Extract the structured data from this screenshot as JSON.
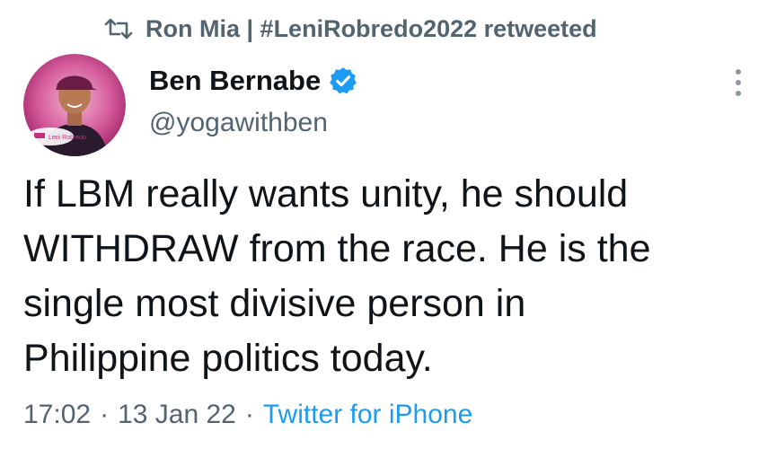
{
  "retweet": {
    "icon": "retweet-icon",
    "text": "Ron Mia | #LeniRobredo2022 retweeted"
  },
  "author": {
    "display_name": "Ben Bernabe",
    "handle": "@yogawithben",
    "verified": true,
    "verified_icon": "verified-badge-icon",
    "avatar_badge_text": "Leni Robredo"
  },
  "tweet": {
    "text": "If LBM really wants unity, he should\nWITHDRAW from the race. He is the\nsingle most divisive person in\nPhilippine politics today."
  },
  "meta": {
    "time": "17:02",
    "separator": "·",
    "date": "13 Jan 22",
    "source": "Twitter for iPhone"
  },
  "colors": {
    "text_primary": "#0f1419",
    "text_secondary": "#536471",
    "accent": "#1d9bf0",
    "avatar_ring": "#c2327a"
  }
}
